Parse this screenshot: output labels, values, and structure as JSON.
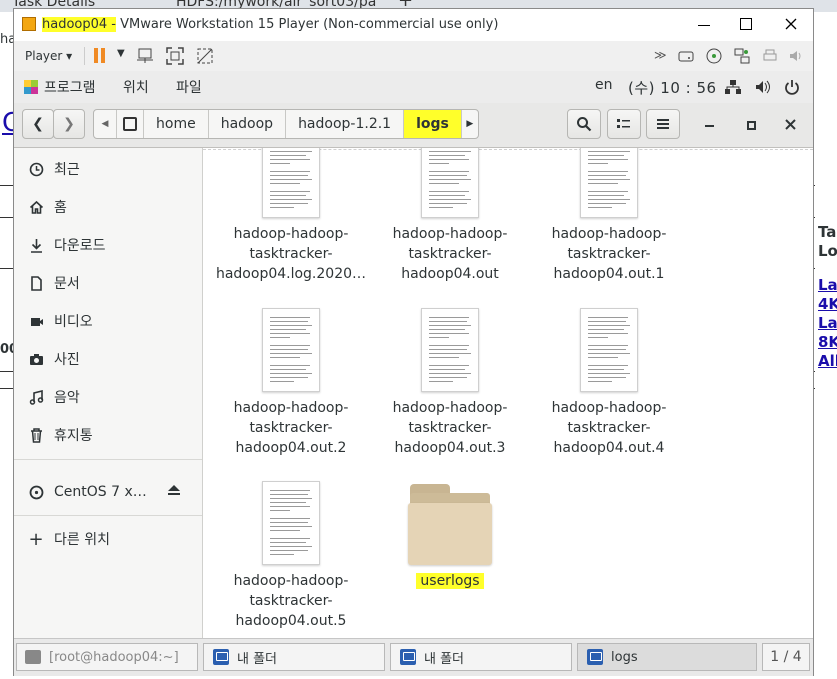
{
  "background": {
    "tab1": "Task Details",
    "tab2": "HDFS:/mywork/air_sort03/pa",
    "left_snippets": [
      "had",
      "C",
      "00"
    ],
    "right_snippets": [
      "Tas",
      "Lo",
      "Las",
      "4K",
      "Las",
      "8K",
      "All"
    ]
  },
  "vmware": {
    "title_vm": "hadoop04 -",
    "title_app": " VMware Workstation 15 Player (Non-commercial use only)",
    "player_label": "Player"
  },
  "gnome_bar": {
    "applications": "프로그램",
    "places": "위치",
    "file_menu": "파일",
    "lang": "en",
    "clock": "(수) 10 : 56"
  },
  "breadcrumbs": [
    "home",
    "hadoop",
    "hadoop-1.2.1",
    "logs"
  ],
  "sidebar": {
    "items": [
      {
        "label": "최근",
        "icon": "clock-icon"
      },
      {
        "label": "홈",
        "icon": "home-icon"
      },
      {
        "label": "다운로드",
        "icon": "download-icon"
      },
      {
        "label": "문서",
        "icon": "document-icon"
      },
      {
        "label": "비디오",
        "icon": "video-icon"
      },
      {
        "label": "사진",
        "icon": "camera-icon"
      },
      {
        "label": "음악",
        "icon": "music-icon"
      },
      {
        "label": "휴지통",
        "icon": "trash-icon"
      }
    ],
    "device": "CentOS 7 x…",
    "other_locations": "다른 위치"
  },
  "files": [
    {
      "lines": [
        "hadoop-hadoop-",
        "tasktracker-",
        "hadoop04.log.2020…"
      ]
    },
    {
      "lines": [
        "hadoop-hadoop-",
        "tasktracker-",
        "hadoop04.out"
      ]
    },
    {
      "lines": [
        "hadoop-hadoop-",
        "tasktracker-",
        "hadoop04.out.1"
      ]
    },
    {
      "lines": [
        "hadoop-hadoop-",
        "tasktracker-",
        "hadoop04.out.2"
      ]
    },
    {
      "lines": [
        "hadoop-hadoop-",
        "tasktracker-",
        "hadoop04.out.3"
      ]
    },
    {
      "lines": [
        "hadoop-hadoop-",
        "tasktracker-",
        "hadoop04.out.4"
      ]
    },
    {
      "lines": [
        "hadoop-hadoop-",
        "tasktracker-",
        "hadoop04.out.5"
      ]
    }
  ],
  "folder": {
    "label": "userlogs"
  },
  "taskbar": {
    "terminal": "[root@hadoop04:~]",
    "folder1": "내 폴더",
    "folder2": "내 폴더",
    "logs": "logs",
    "workspace": "1 / 4"
  },
  "colors": {
    "highlight": "#ffff2a",
    "folder": "#e3d2b4",
    "pause": "#f08a24"
  }
}
